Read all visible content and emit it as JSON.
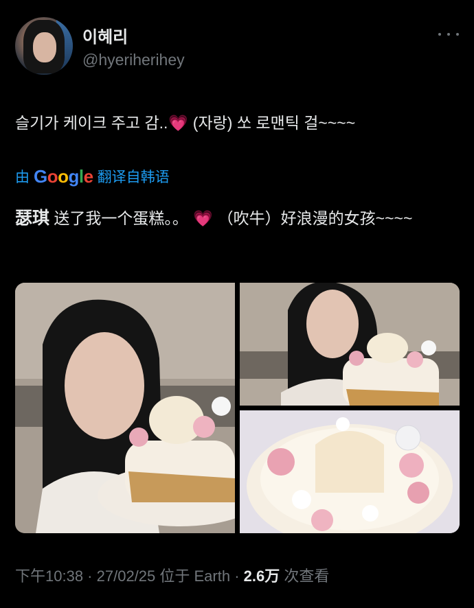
{
  "author": {
    "display_name": "이혜리",
    "handle": "@hyeriherihey",
    "avatar_icon": "profile-photo"
  },
  "tweet": {
    "text_before_emoji": "슬기가 케이크 주고 감..",
    "emoji": "💗",
    "text_after_emoji": " (자랑) 쏘 로맨틱 걸~~~~"
  },
  "translation": {
    "prefix": "由",
    "google": [
      "G",
      "o",
      "o",
      "g",
      "l",
      "e"
    ],
    "suffix": "翻译自韩语",
    "strong_name": "瑟琪",
    "text_part1": " 送了我一个蛋糕。。 ",
    "emoji": "💗",
    "text_part2": " （吹牛）好浪漫的女孩~~~~"
  },
  "media": {
    "image_count": 3
  },
  "meta": {
    "time": "下午10:38",
    "sep1": " · ",
    "date": "27/02/25",
    "location_prefix": " 位于 ",
    "location": "Earth",
    "sep2": " · ",
    "views": "2.6万",
    "views_label": " 次查看"
  },
  "colors": {
    "background": "#000000",
    "text": "#e7e9ea",
    "muted": "#71767b",
    "link": "#1d9bf0"
  }
}
